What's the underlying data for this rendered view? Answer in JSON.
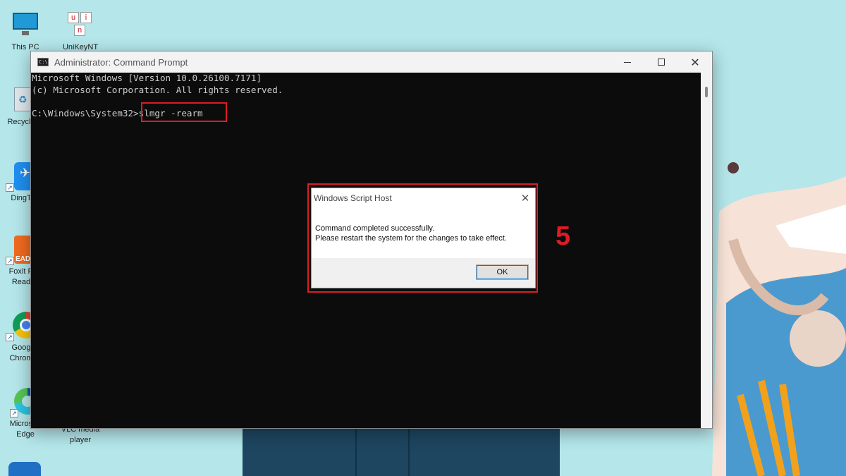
{
  "desktop": {
    "icons": [
      {
        "label": "This PC"
      },
      {
        "label": "UniKeyNT"
      },
      {
        "label": "Recycle"
      },
      {
        "label": "DingT"
      },
      {
        "label": "Foxit R Read"
      },
      {
        "label": "Goog Chrom"
      },
      {
        "label": "Microsoft Edge"
      },
      {
        "label": "VLC media player"
      }
    ]
  },
  "cmd": {
    "title": "Administrator: Command Prompt",
    "lines": [
      "Microsoft Windows [Version 10.0.26100.7171]",
      "(c) Microsoft Corporation. All rights reserved."
    ],
    "prompt": "C:\\Windows\\System32>",
    "command": "slmgr -rearm"
  },
  "dialog": {
    "title": "Windows Script Host",
    "message_line1": "Command completed successfully.",
    "message_line2": "Please restart the system for the changes to take effect.",
    "ok_label": "OK"
  },
  "annotation": {
    "step": "5"
  },
  "colors": {
    "highlight": "#e01b24",
    "console_bg": "#0c0c0c",
    "console_text": "#cccccc"
  }
}
